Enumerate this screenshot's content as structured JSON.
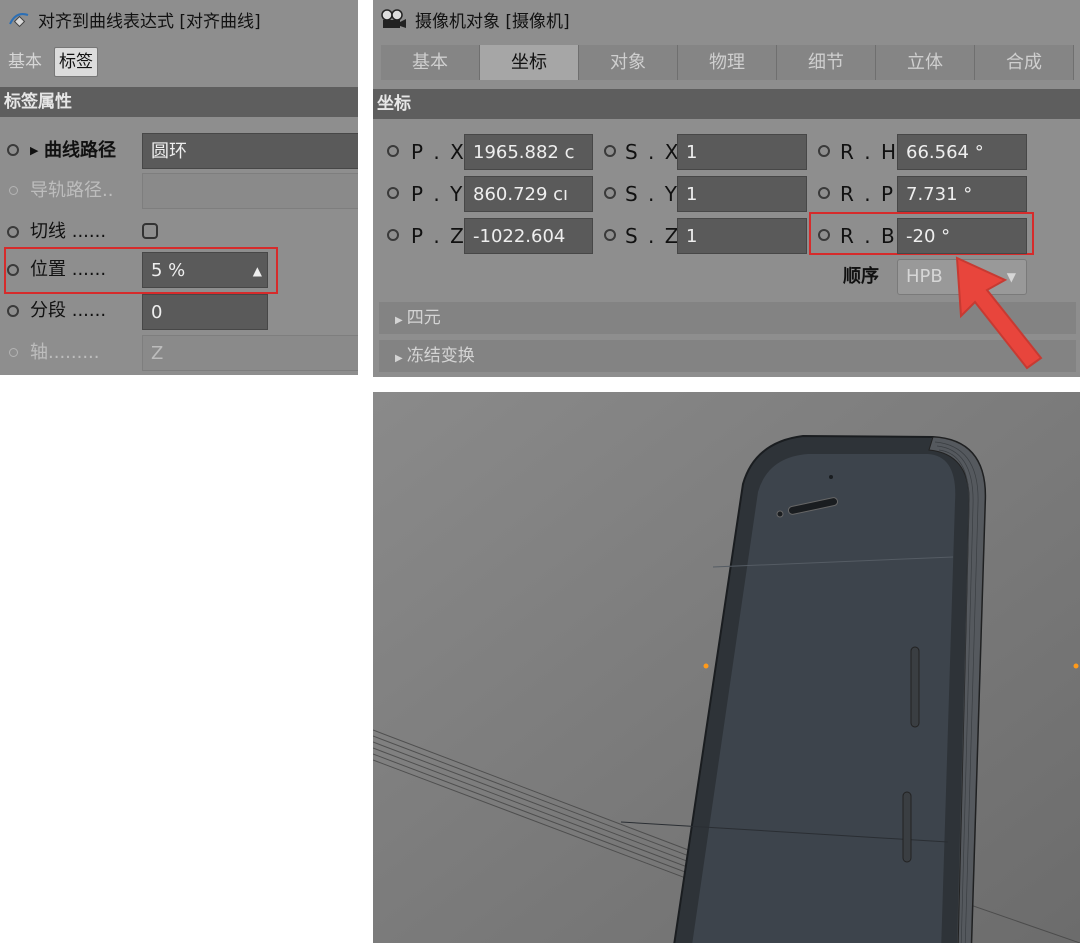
{
  "left_panel": {
    "title": "对齐到曲线表达式 [对齐曲线]",
    "title_icon": "align-curve-tag-icon",
    "tabs": [
      "基本",
      "标签"
    ],
    "section": "标签属性",
    "rows": {
      "curve_path": {
        "label": "曲线路径",
        "value": "圆环"
      },
      "rail_path": {
        "label": "导轨路径.."
      },
      "tangent": {
        "label": "切线 ......"
      },
      "position": {
        "label": "位置 ......",
        "value": "5 %"
      },
      "segment": {
        "label": "分段 ......",
        "value": "0"
      },
      "axis": {
        "label": "轴.........",
        "value": "Z"
      }
    }
  },
  "right_panel": {
    "title": "摄像机对象 [摄像机]",
    "title_icon": "camera-icon",
    "tabs": [
      "基本",
      "坐标",
      "对象",
      "物理",
      "细节",
      "立体",
      "合成"
    ],
    "active_tab": "坐标",
    "section": "坐标",
    "coords": {
      "px": {
        "label": "P . X",
        "value": "1965.882 c"
      },
      "py": {
        "label": "P . Y",
        "value": "860.729 cı"
      },
      "pz": {
        "label": "P . Z",
        "value": "-1022.604"
      },
      "sx": {
        "label": "S . X",
        "value": "1"
      },
      "sy": {
        "label": "S . Y",
        "value": "1"
      },
      "sz": {
        "label": "S . Z",
        "value": "1"
      },
      "rh": {
        "label": "R . H",
        "value": "66.564 °"
      },
      "rp": {
        "label": "R . P",
        "value": "7.731 °"
      },
      "rb": {
        "label": "R . B",
        "value": "-20 °"
      }
    },
    "order": {
      "label": "顺序",
      "value": "HPB"
    },
    "collapsibles": [
      "四元",
      "冻结变换"
    ]
  },
  "viewport": {
    "corner_mark": "○"
  },
  "colors": {
    "highlight": "#d62b2b",
    "arrow": "#e8453c",
    "vertex_dot": "#ff9a1a"
  }
}
